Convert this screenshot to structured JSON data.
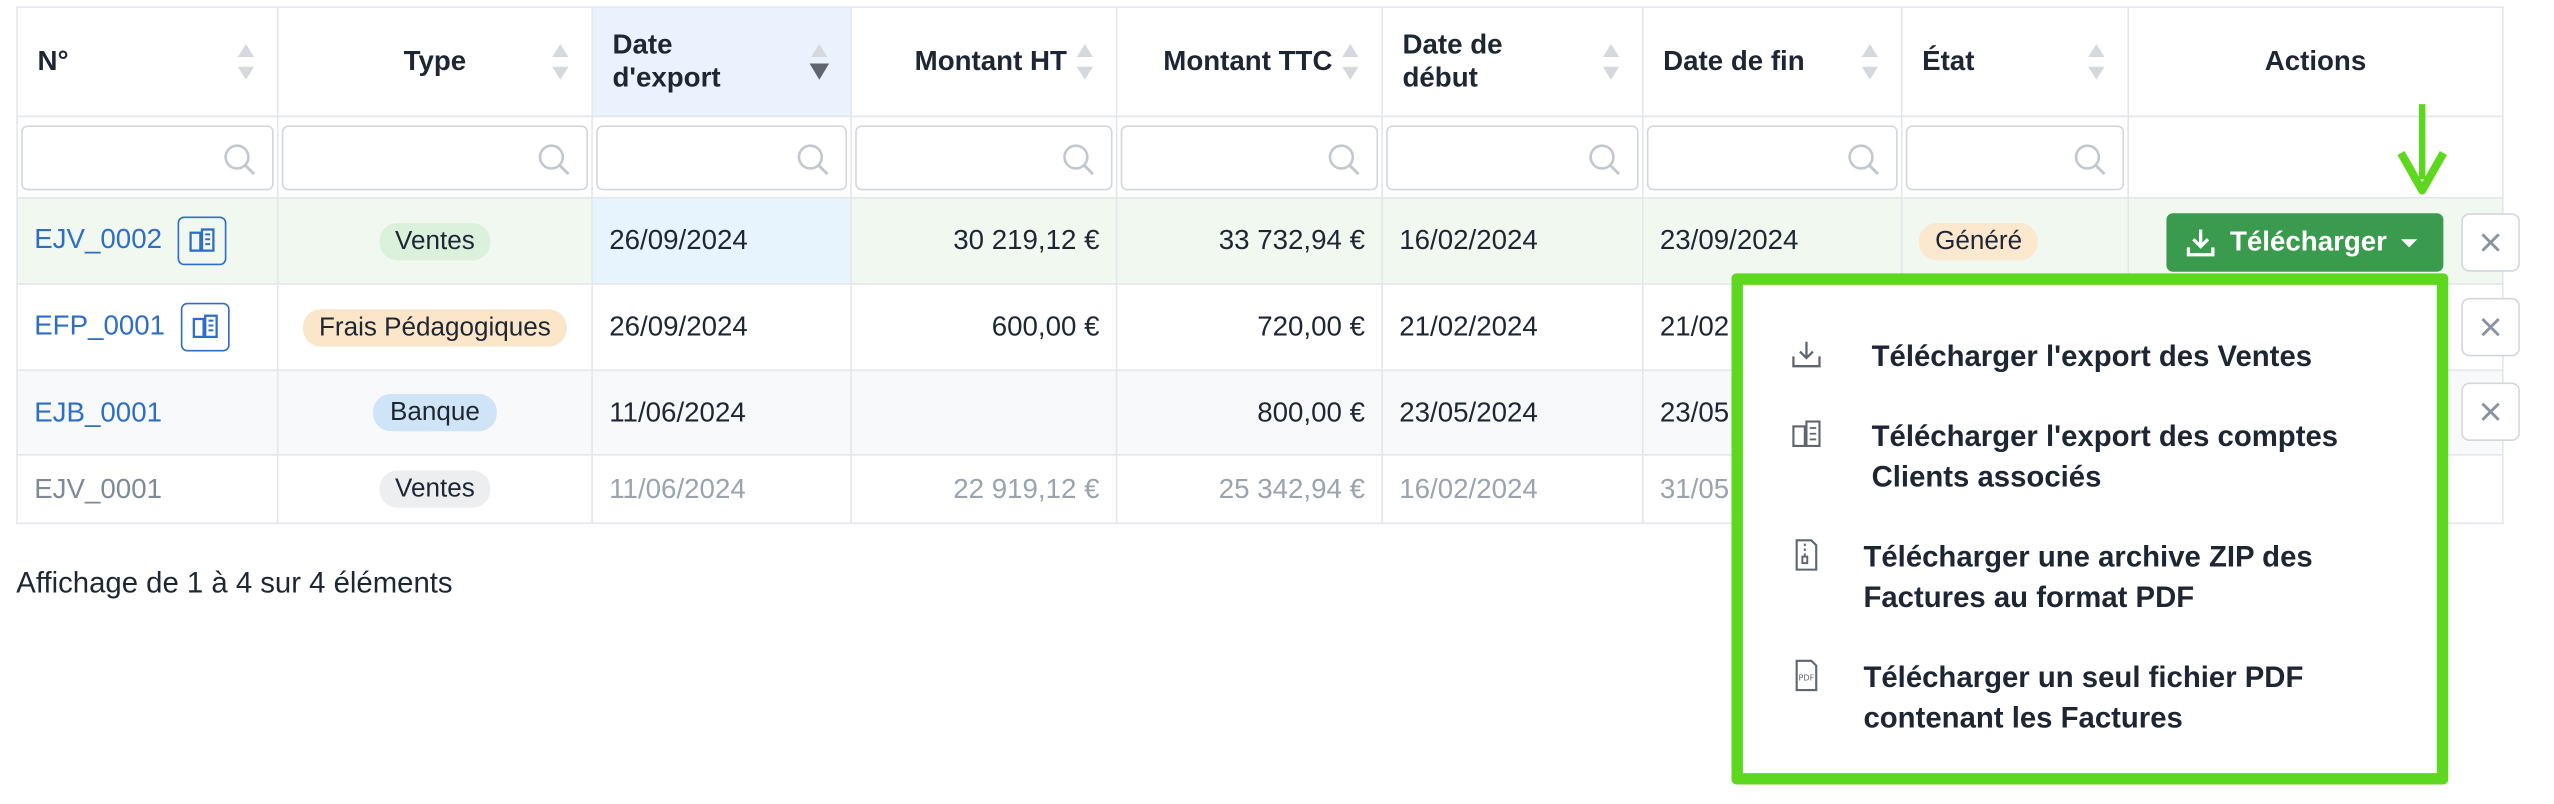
{
  "columns": [
    {
      "label": "N°"
    },
    {
      "label": "Type"
    },
    {
      "label": "Date\nd'export"
    },
    {
      "label": "Montant HT"
    },
    {
      "label": "Montant TTC"
    },
    {
      "label": "Date de\ndébut"
    },
    {
      "label": "Date de fin"
    },
    {
      "label": "État"
    },
    {
      "label": "Actions"
    }
  ],
  "rows": [
    {
      "ref": "EJV_0002",
      "type": "Ventes",
      "type_color": "#dcf1dc",
      "export_date": "26/09/2024",
      "ht": "30 219,12 €",
      "ttc": "33 732,94 €",
      "start": "16/02/2024",
      "end": "23/09/2024",
      "state": "Généré",
      "state_color": "#fbe8cf"
    },
    {
      "ref": "EFP_0001",
      "type": "Frais Pédagogiques",
      "type_color": "#fbe6c9",
      "export_date": "26/09/2024",
      "ht": "600,00 €",
      "ttc": "720,00 €",
      "start": "21/02/2024",
      "end": "21/02"
    },
    {
      "ref": "EJB_0001",
      "type": "Banque",
      "type_color": "#cfe4f6",
      "export_date": "11/06/2024",
      "ht": "",
      "ttc": "800,00 €",
      "start": "23/05/2024",
      "end": "23/05"
    },
    {
      "ref": "EJV_0001",
      "type": "Ventes",
      "type_color": "#eceef0",
      "export_date": "11/06/2024",
      "ht": "22 919,12 €",
      "ttc": "25 342,94 €",
      "start": "16/02/2024",
      "end": "31/05"
    }
  ],
  "download_button": {
    "label": "Télécharger"
  },
  "menu": [
    {
      "label": "Télécharger l'export des Ventes",
      "icon": "download-icon"
    },
    {
      "label": "Télécharger l'export des comptes\nClients associés",
      "icon": "client-accounts-icon"
    },
    {
      "label": "Télécharger une archive ZIP des\nFactures au format PDF",
      "icon": "zip-file-icon"
    },
    {
      "label": "Télécharger un seul fichier PDF\ncontenant les Factures",
      "icon": "pdf-file-icon"
    }
  ],
  "footer": {
    "text": "Affichage de 1 à 4 sur 4 éléments"
  },
  "colors": {
    "primary_button": "#3a9a4d",
    "highlight": "#5ed81f",
    "link": "#2e6ec5"
  }
}
